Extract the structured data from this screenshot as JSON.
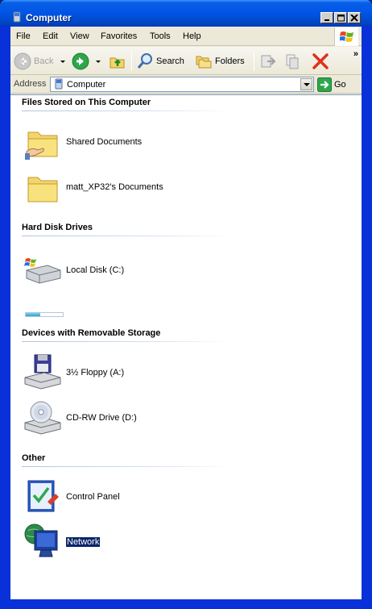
{
  "window": {
    "title": "Computer"
  },
  "menu": {
    "items": [
      "File",
      "Edit",
      "View",
      "Favorites",
      "Tools",
      "Help"
    ]
  },
  "toolbar": {
    "back_label": "Back",
    "search_label": "Search",
    "folders_label": "Folders",
    "overflow_label": "»"
  },
  "address": {
    "label": "Address",
    "value": "Computer",
    "go_label": "Go"
  },
  "groups": [
    {
      "title": "Files Stored on This Computer",
      "items": [
        {
          "name": "Shared Documents",
          "icon": "shared-folder-icon"
        },
        {
          "name": "matt_XP32's Documents",
          "icon": "folder-icon"
        }
      ]
    },
    {
      "title": "Hard Disk Drives",
      "items": [
        {
          "name": "Local Disk (C:)",
          "icon": "hard-disk-icon",
          "used_fraction": 0.4
        }
      ]
    },
    {
      "title": "Devices with Removable Storage",
      "items": [
        {
          "name": "3½ Floppy (A:)",
          "icon": "floppy-drive-icon"
        },
        {
          "name": "CD-RW Drive (D:)",
          "icon": "cd-drive-icon"
        }
      ]
    },
    {
      "title": "Other",
      "items": [
        {
          "name": "Control Panel",
          "icon": "control-panel-icon"
        },
        {
          "name": "Network",
          "icon": "network-icon",
          "selected": true
        }
      ]
    }
  ],
  "colors": {
    "titlebar": "#0055e5",
    "window_frame": "#0831d9",
    "chrome": "#ece9d8",
    "selection": "#0a246a"
  }
}
